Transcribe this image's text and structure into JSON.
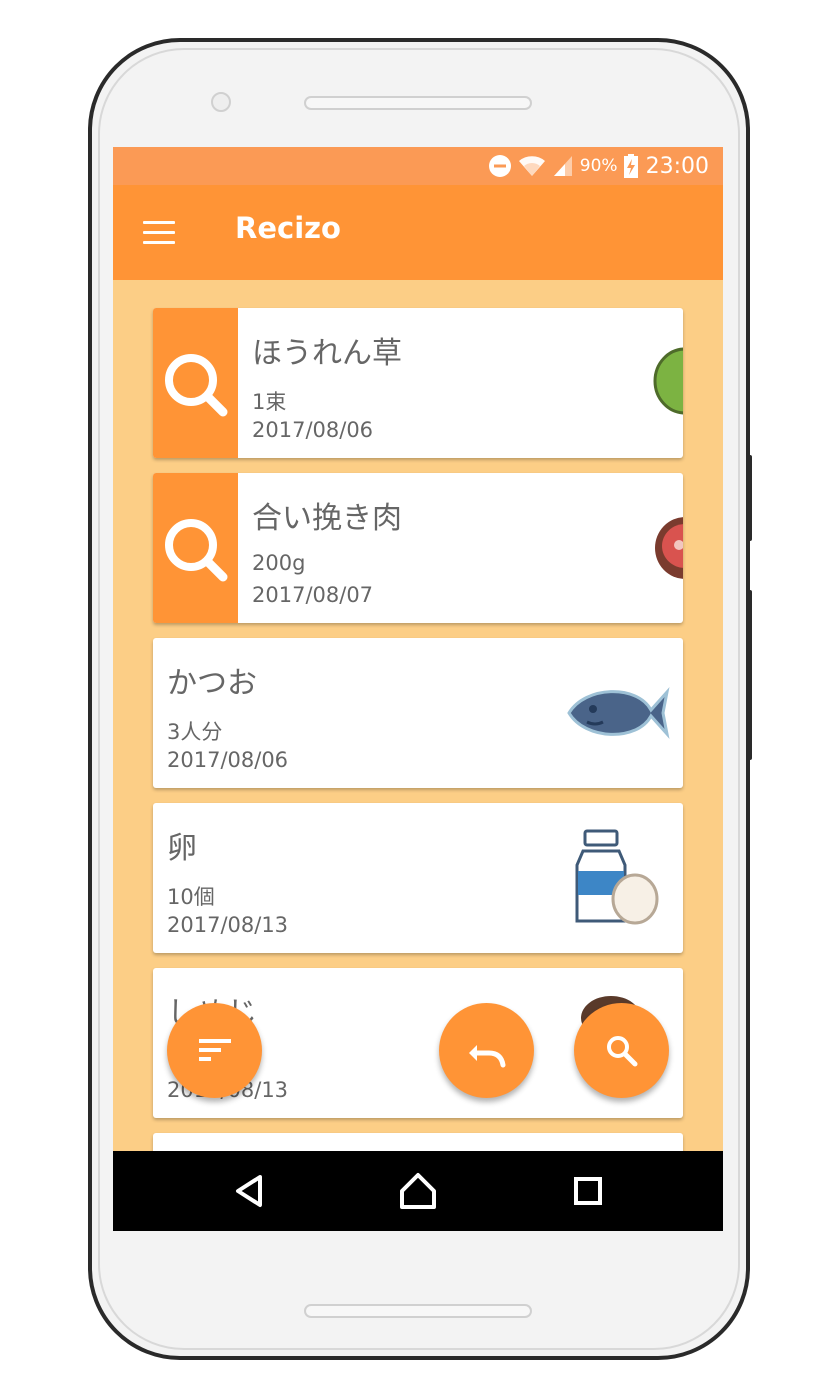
{
  "status_bar": {
    "battery_percent": "90%",
    "time": "23:00",
    "icons": [
      "do-not-disturb-icon",
      "wifi-icon",
      "signal-icon",
      "battery-charging-icon"
    ]
  },
  "app_bar": {
    "title": "Recizo",
    "menu_icon": "hamburger-menu-icon"
  },
  "items": [
    {
      "name": "ほうれん草",
      "quantity": "1束",
      "date": "2017/08/06",
      "searchable": true,
      "image": "spinach-icon"
    },
    {
      "name": "合い挽き肉",
      "quantity": "200g",
      "date": "2017/08/07",
      "searchable": true,
      "image": "meat-icon"
    },
    {
      "name": "かつお",
      "quantity": "3人分",
      "date": "2017/08/06",
      "searchable": false,
      "image": "fish-icon"
    },
    {
      "name": "卵",
      "quantity": "10個",
      "date": "2017/08/13",
      "searchable": false,
      "image": "milk-egg-icon"
    },
    {
      "name": "しめじ",
      "quantity": "",
      "date": "2017/08/13",
      "searchable": false,
      "image": "mushroom-icon"
    }
  ],
  "fabs": {
    "sort": "sort-icon",
    "undo": "undo-icon",
    "search": "search-icon"
  },
  "nav_bar": [
    "back-icon",
    "home-icon",
    "recents-icon"
  ],
  "colors": {
    "primary": "#ff9436",
    "status_bar": "#fb9a55",
    "background": "#fcce86"
  }
}
